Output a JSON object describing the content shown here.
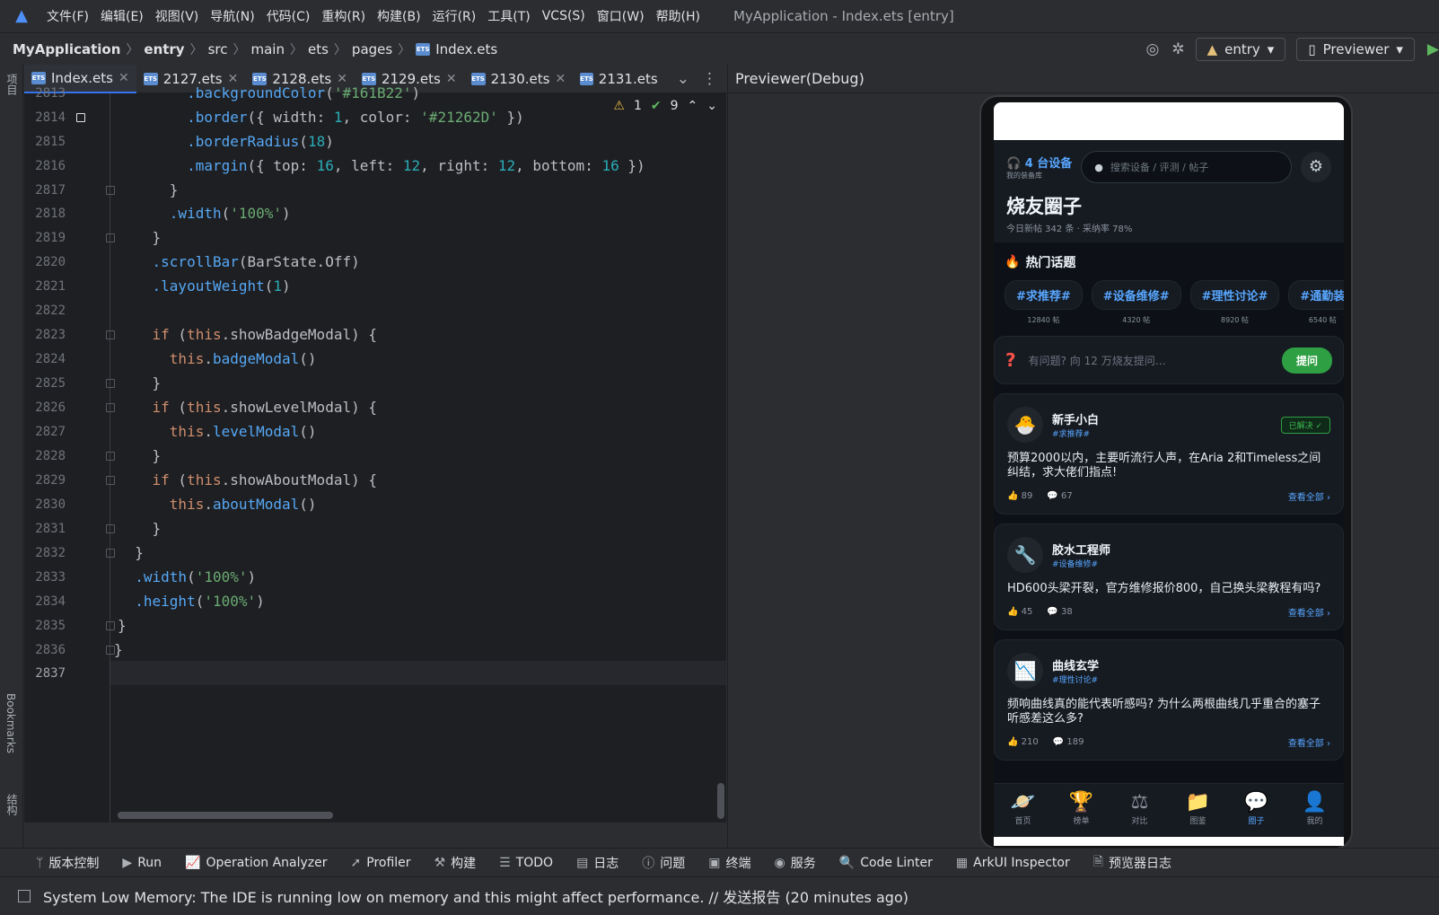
{
  "menu": {
    "items": [
      "文件(F)",
      "编辑(E)",
      "视图(V)",
      "导航(N)",
      "代码(C)",
      "重构(R)",
      "构建(B)",
      "运行(R)",
      "工具(T)",
      "VCS(S)",
      "窗口(W)",
      "帮助(H)"
    ],
    "window_title": "MyApplication - Index.ets [entry]"
  },
  "breadcrumb": {
    "project": "MyApplication",
    "module": "entry",
    "parts": [
      "src",
      "main",
      "ets",
      "pages"
    ],
    "file": "Index.ets"
  },
  "toolbar": {
    "module_select": "entry",
    "run_config": "Previewer"
  },
  "left_strip": {
    "project": "项目",
    "bookmarks": "Bookmarks",
    "structure": "结构"
  },
  "tabs": [
    "Index.ets",
    "2127.ets",
    "2128.ets",
    "2129.ets",
    "2130.ets",
    "2131.ets"
  ],
  "inspections": {
    "warnings": "1",
    "ok": "9"
  },
  "editor": {
    "lines": [
      "2813",
      "2814",
      "2815",
      "2816",
      "2817",
      "2818",
      "2819",
      "2820",
      "2821",
      "2822",
      "2823",
      "2824",
      "2825",
      "2826",
      "2827",
      "2828",
      "2829",
      "2830",
      "2831",
      "2832",
      "2833",
      "2834",
      "2835",
      "2836",
      "2837"
    ]
  },
  "preview": {
    "title": "Previewer(Debug)",
    "app": {
      "device_count": "4 台设备",
      "device_sub": "我的装备库",
      "search_placeholder": "搜索设备 / 评测 / 帖子",
      "title": "烧友圈子",
      "stats": "今日新帖 342 条 · 采纳率 78%",
      "hot_title": "热门话题",
      "topics": [
        {
          "name": "#求推荐#",
          "count": "12840 帖"
        },
        {
          "name": "#设备维修#",
          "count": "4320 帖"
        },
        {
          "name": "#理性讨论#",
          "count": "8920 帖"
        },
        {
          "name": "#通勤装",
          "count": "6540 帖"
        }
      ],
      "ask_placeholder": "有问题? 向 12 万烧友提问…",
      "ask_button": "提问",
      "posts": [
        {
          "user": "新手小白",
          "tag": "#求推荐#",
          "badge": "已解决 ✓",
          "text": "预算2000以内，主要听流行人声，在Aria 2和Timeless之间纠结，求大佬们指点!",
          "likes": "89",
          "comments": "67",
          "more": "查看全部 ›"
        },
        {
          "user": "胶水工程师",
          "tag": "#设备维修#",
          "badge": "",
          "text": "HD600头梁开裂，官方维修报价800，自己换头梁教程有吗?",
          "likes": "45",
          "comments": "38",
          "more": "查看全部 ›"
        },
        {
          "user": "曲线玄学",
          "tag": "#理性讨论#",
          "badge": "",
          "text": "频响曲线真的能代表听感吗? 为什么两根曲线几乎重合的塞子听感差这么多?",
          "likes": "210",
          "comments": "189",
          "more": "查看全部 ›"
        }
      ],
      "nav": [
        {
          "label": "首页",
          "icon": "🪐"
        },
        {
          "label": "榜单",
          "icon": "🏆"
        },
        {
          "label": "对比",
          "icon": "⚖"
        },
        {
          "label": "图鉴",
          "icon": "📁"
        },
        {
          "label": "圈子",
          "icon": "💬"
        },
        {
          "label": "我的",
          "icon": "👤"
        }
      ]
    }
  },
  "bottom_tools": [
    "版本控制",
    "Run",
    "Operation Analyzer",
    "Profiler",
    "构建",
    "TODO",
    "日志",
    "问题",
    "终端",
    "服务",
    "Code Linter",
    "ArkUI Inspector",
    "预览器日志"
  ],
  "status": {
    "message": "System Low Memory: The IDE is running low on memory and this might affect performance. // 发送报告 (20 minutes ago)"
  }
}
